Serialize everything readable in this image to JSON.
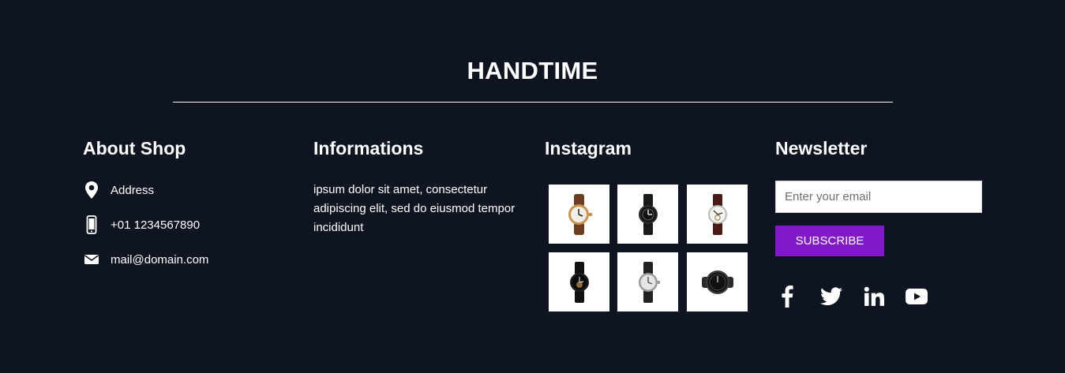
{
  "brand": {
    "title": "HANDTIME"
  },
  "about": {
    "heading": "About Shop",
    "items": [
      {
        "icon": "map-pin-icon",
        "text": "Address"
      },
      {
        "icon": "mobile-phone-icon",
        "text": "+01 1234567890"
      },
      {
        "icon": "envelope-icon",
        "text": "mail@domain.com"
      }
    ]
  },
  "info": {
    "heading": "Informations",
    "text": "ipsum dolor sit amet, consectetur adipiscing elit, sed do eiusmod tempor incididunt"
  },
  "instagram": {
    "heading": "Instagram",
    "images": [
      "watch-gold-brown-strap",
      "watch-black-strap",
      "watch-white-dial-brown-strap",
      "watch-black-skeleton",
      "watch-silver-dial",
      "watch-smart-black"
    ]
  },
  "newsletter": {
    "heading": "Newsletter",
    "email_placeholder": "Enter your email",
    "email_value": "",
    "subscribe_label": "SUBSCRIBE",
    "social": [
      "facebook-icon",
      "twitter-icon",
      "linkedin-icon",
      "youtube-icon"
    ]
  },
  "colors": {
    "background": "#0f1520",
    "accent": "#8318c9",
    "text": "#ffffff"
  }
}
